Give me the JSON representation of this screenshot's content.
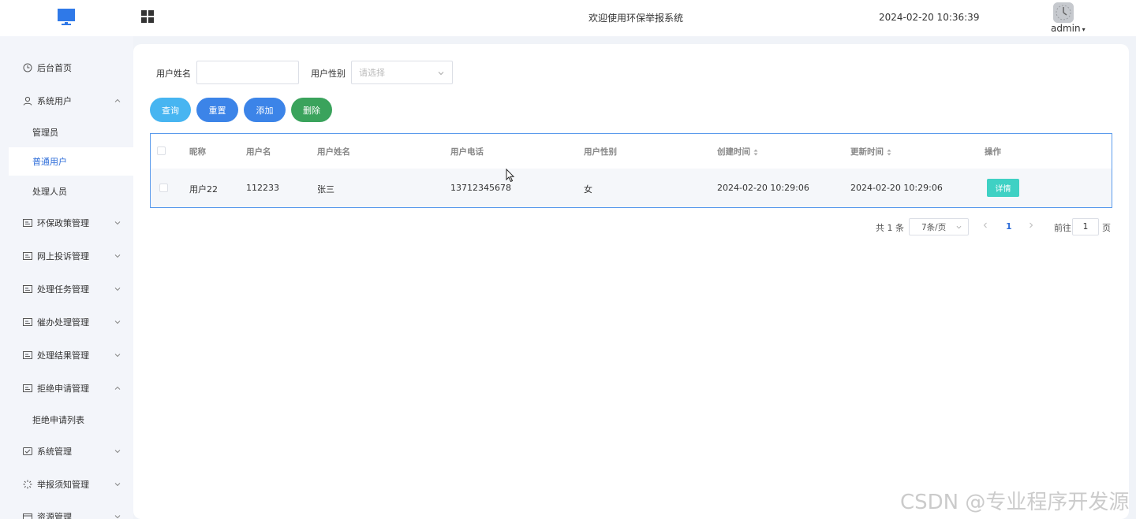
{
  "header": {
    "welcome": "欢迎使用环保举报系统",
    "datetime": "2024-02-20 10:36:39",
    "user": "admin"
  },
  "sidebar": {
    "items": [
      {
        "label": "后台首页"
      },
      {
        "label": "系统用户"
      },
      {
        "label": "管理员"
      },
      {
        "label": "普通用户"
      },
      {
        "label": "处理人员"
      },
      {
        "label": "环保政策管理"
      },
      {
        "label": "网上投诉管理"
      },
      {
        "label": "处理任务管理"
      },
      {
        "label": "催办处理管理"
      },
      {
        "label": "处理结果管理"
      },
      {
        "label": "拒绝申请管理"
      },
      {
        "label": "拒绝申请列表"
      },
      {
        "label": "系统管理"
      },
      {
        "label": "举报须知管理"
      },
      {
        "label": "资源管理"
      }
    ]
  },
  "filters": {
    "name_label": "用户姓名",
    "name_value": "",
    "gender_label": "用户性别",
    "gender_placeholder": "请选择"
  },
  "buttons": {
    "query": "查询",
    "reset": "重置",
    "add": "添加",
    "delete": "删除"
  },
  "table": {
    "columns": [
      "昵称",
      "用户名",
      "用户姓名",
      "用户电话",
      "用户性别",
      "创建时间",
      "更新时间",
      "操作"
    ],
    "rows": [
      {
        "nickname": "用户22",
        "username": "112233",
        "realname": "张三",
        "phone": "13712345678",
        "gender": "女",
        "created": "2024-02-20 10:29:06",
        "updated": "2024-02-20 10:29:06",
        "action": "详情"
      }
    ]
  },
  "pagination": {
    "total": "共 1 条",
    "page_size": "7条/页",
    "current_page": "1",
    "goto_label": "前往",
    "goto_value": "1",
    "page_suffix": "页"
  },
  "watermark": "CSDN @专业程序开发源",
  "colors": {
    "primary": "#3c84e8",
    "query": "#47b5f1",
    "delete": "#3aa35c",
    "detail": "#3fd1c4",
    "active_menu": "#2f6ed9"
  }
}
